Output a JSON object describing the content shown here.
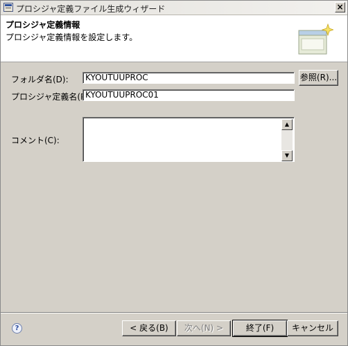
{
  "window": {
    "title": "プロシジャ定義ファイル生成ウィザード",
    "close_label": "×"
  },
  "banner": {
    "title": "プロシジャ定義情報",
    "description": "プロシジャ定義情報を設定します。"
  },
  "form": {
    "folder_label": "フォルダ名(D):",
    "folder_value": "KYOUTUUPROC",
    "browse_label": "参照(R)...",
    "procedure_label": "プロシジャ定義名(P):",
    "procedure_value": "KYOUTUUPROC01",
    "comment_label": "コメント(C):",
    "comment_value": ""
  },
  "footer": {
    "help_label": "?",
    "back_label": "< 戻る(B)",
    "next_label": "次へ(N) >",
    "finish_label": "終了(F)",
    "cancel_label": "キャンセル"
  }
}
